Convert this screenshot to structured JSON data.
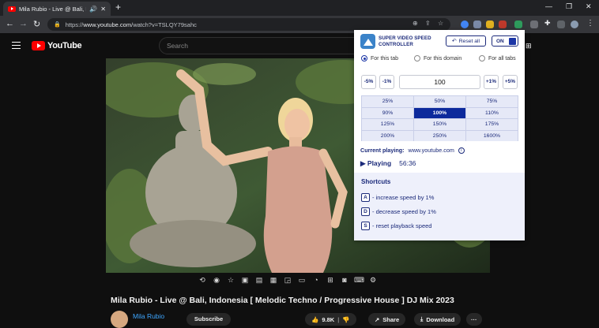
{
  "browser": {
    "tab_title": "Mila Rubio - Live @ Bali, Indo",
    "url_host": "www.youtube.com",
    "url_path": "/watch?v=TSLQY79sahc",
    "url_scheme": "https://",
    "new_tab": "+",
    "close_tab": "✕",
    "audio_icon": "🔊",
    "back": "←",
    "forward": "→",
    "reload": "↻",
    "minimize": "—",
    "maximize": "❐",
    "close": "✕",
    "menu": "⋮"
  },
  "youtube": {
    "logo_text": "YouTube",
    "search_placeholder": "Search",
    "video_title": "Mila Rubio - Live @ Bali, Indonesia [ Melodic Techno / Progressive House ] DJ Mix 2023",
    "channel": "Mila Rubio",
    "subscribe": "Subscribe",
    "likes": "9.8K",
    "share": "Share",
    "download": "Download",
    "more": "···"
  },
  "extension": {
    "name_line1": "SUPER VIDEO SPEED",
    "name_line2": "CONTROLLER",
    "reset_label": "Reset all",
    "toggle_label": "ON",
    "scopes": [
      {
        "label": "For this tab",
        "selected": true
      },
      {
        "label": "For this domain",
        "selected": false
      },
      {
        "label": "For all tabs",
        "selected": false
      }
    ],
    "step_buttons": {
      "minus5": "-5%",
      "minus1": "-1%",
      "plus1": "+1%",
      "plus5": "+5%"
    },
    "current_speed": "100",
    "presets": [
      "25%",
      "50%",
      "75%",
      "90%",
      "100%",
      "110%",
      "125%",
      "150%",
      "175%",
      "200%",
      "250%",
      "1600%"
    ],
    "active_preset": "100%",
    "current_playing_label": "Current playing:",
    "current_playing_domain": "www.youtube.com",
    "playing_label": "▶ Playing",
    "playing_time": "56:36",
    "shortcuts_title": "Shortcuts",
    "shortcuts": [
      {
        "key": "A",
        "text": "- increase speed by 1%"
      },
      {
        "key": "D",
        "text": "- decrease speed by 1%"
      },
      {
        "key": "S",
        "text": "- reset playback speed"
      }
    ]
  },
  "colors": {
    "brand_navy": "#1b2a7a",
    "active_cell": "#0d2a9c",
    "youtube_red": "#ff0000"
  }
}
